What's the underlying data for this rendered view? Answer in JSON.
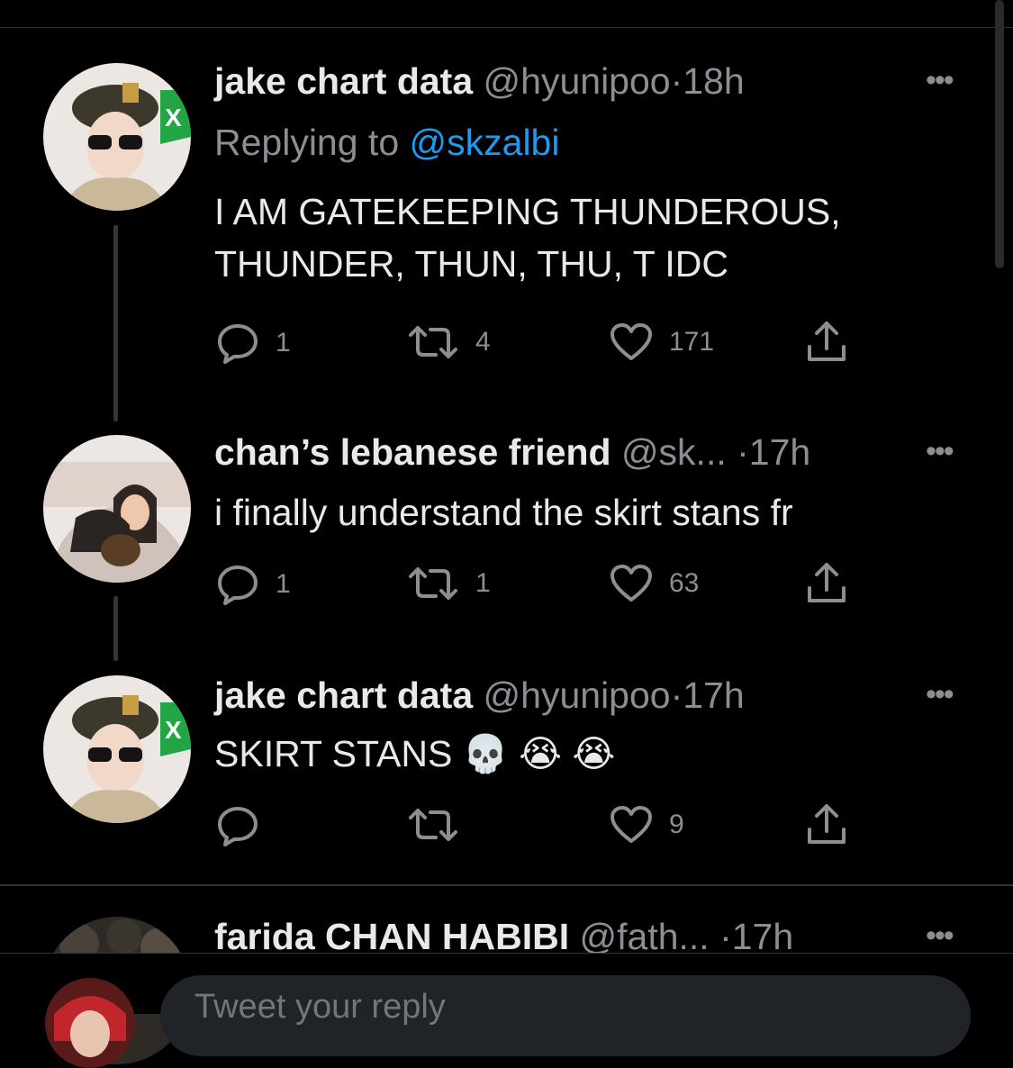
{
  "tweets": [
    {
      "name": "jake chart data",
      "handle": "@hyunipoo",
      "dot": "·",
      "time": "18h",
      "replying_prefix": "Replying to ",
      "replying_to": "@skzalbi",
      "text_lines": [
        "I AM GATEKEEPING THUNDEROUS,",
        "THUNDER, THUN, THU, T IDC"
      ],
      "replies": "1",
      "retweets": "4",
      "likes": "171",
      "more": "•••"
    },
    {
      "name": "chan’s lebanese friend",
      "handle": "@sk...",
      "dot": "·",
      "time": "17h",
      "text_lines": [
        "i finally understand the skirt stans fr"
      ],
      "replies": "1",
      "retweets": "1",
      "likes": "63",
      "more": "•••"
    },
    {
      "name": "jake chart data",
      "handle": "@hyunipoo",
      "dot": "·",
      "time": "17h",
      "text_lines": [
        "SKIRT STANS 💀 😭 😭"
      ],
      "replies": "",
      "retweets": "",
      "likes": "9",
      "more": "•••"
    },
    {
      "name": "farida CHAN HABIBI",
      "handle": "@fath...",
      "dot": "·",
      "time": "17h",
      "more": "•••"
    }
  ],
  "composer": {
    "placeholder": "Tweet your reply"
  },
  "colors": {
    "background": "#000000",
    "text": "#e7e9ea",
    "muted": "#8b8f94",
    "link": "#1d9bf0",
    "divider": "#2f3336"
  },
  "icons": [
    "reply-icon",
    "retweet-icon",
    "like-icon",
    "share-icon",
    "more-icon"
  ]
}
